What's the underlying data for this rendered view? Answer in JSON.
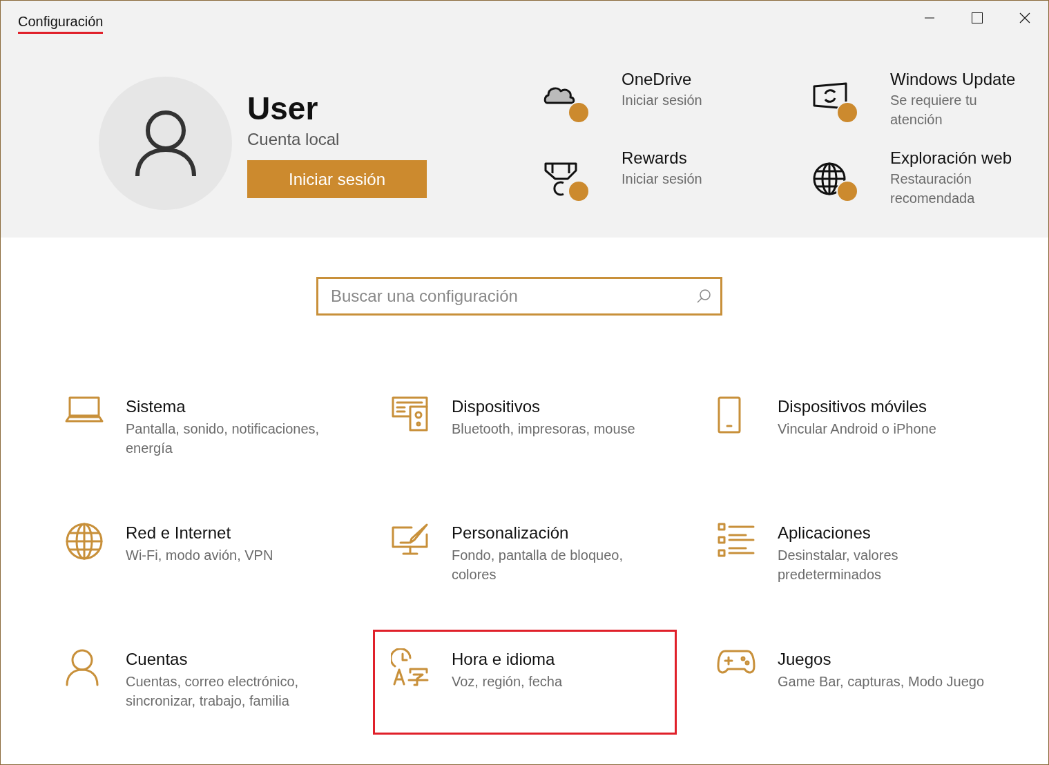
{
  "window": {
    "title": "Configuración",
    "title_underlined": true
  },
  "account": {
    "name": "User",
    "type": "Cuenta local",
    "button": "Iniciar sesión"
  },
  "quick_links": [
    {
      "kind": "cloud",
      "title": "OneDrive",
      "subtitle": "Iniciar sesión"
    },
    {
      "kind": "update",
      "title": "Windows Update",
      "subtitle": "Se requiere tu atención"
    },
    {
      "kind": "medal",
      "title": "Rewards",
      "subtitle": "Iniciar sesión"
    },
    {
      "kind": "globe",
      "title": "Exploración web",
      "subtitle": "Restauración recomendada"
    }
  ],
  "search": {
    "placeholder": "Buscar una configuración"
  },
  "categories": [
    {
      "kind": "laptop",
      "title": "Sistema",
      "description": "Pantalla, sonido, notificaciones, energía",
      "highlighted": false
    },
    {
      "kind": "devices",
      "title": "Dispositivos",
      "description": "Bluetooth, impresoras, mouse",
      "highlighted": false
    },
    {
      "kind": "phone",
      "title": "Dispositivos móviles",
      "description": "Vincular Android o iPhone",
      "highlighted": false
    },
    {
      "kind": "globe",
      "title": "Red e Internet",
      "description": "Wi-Fi, modo avión, VPN",
      "highlighted": false
    },
    {
      "kind": "paint",
      "title": "Personalización",
      "description": "Fondo, pantalla de bloqueo, colores",
      "highlighted": false
    },
    {
      "kind": "apps",
      "title": "Aplicaciones",
      "description": "Desinstalar, valores predeterminados",
      "highlighted": false
    },
    {
      "kind": "person",
      "title": "Cuentas",
      "description": "Cuentas, correo electrónico, sincronizar, trabajo, familia",
      "highlighted": false
    },
    {
      "kind": "timelang",
      "title": "Hora e idioma",
      "description": "Voz, región, fecha",
      "highlighted": true
    },
    {
      "kind": "gamepad",
      "title": "Juegos",
      "description": "Game Bar, capturas, Modo Juego",
      "highlighted": false
    }
  ]
}
